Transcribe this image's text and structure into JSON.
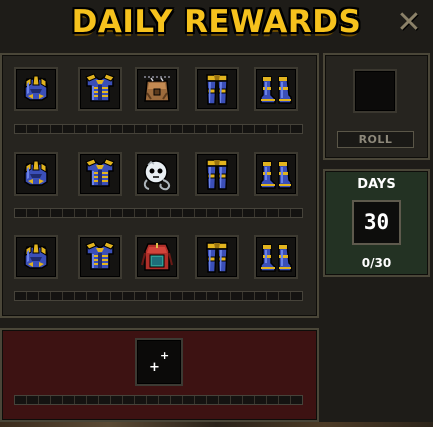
{
  "header": {
    "title": "DAILY REWARDS",
    "close_label": "✕"
  },
  "reward_rows": [
    {
      "items": [
        {
          "name": "helmet-icon"
        },
        {
          "name": "chestplate-icon"
        },
        {
          "name": "leather-bag-icon"
        },
        {
          "name": "leggings-icon"
        },
        {
          "name": "boots-icon"
        }
      ],
      "progress": 0
    },
    {
      "items": [
        {
          "name": "helmet-icon"
        },
        {
          "name": "chestplate-icon"
        },
        {
          "name": "skull-compass-icon"
        },
        {
          "name": "leggings-icon"
        },
        {
          "name": "boots-icon"
        }
      ],
      "progress": 0
    },
    {
      "items": [
        {
          "name": "helmet-icon"
        },
        {
          "name": "chestplate-icon"
        },
        {
          "name": "red-backpack-icon"
        },
        {
          "name": "leggings-icon"
        },
        {
          "name": "boots-icon"
        }
      ],
      "progress": 0
    }
  ],
  "roll": {
    "button_label": "ROLL"
  },
  "days": {
    "label": "DAYS",
    "value": "30",
    "progress_text": "0/30"
  },
  "bonus": {
    "sparkle_icon": "sparkle-icon",
    "progress": 0
  },
  "colors": {
    "title": "#f6c21d",
    "armor_gold": "#e2b41f",
    "armor_blue": "#3b4fb8",
    "days_panel": "#233223",
    "bonus_panel": "#3d1212"
  }
}
